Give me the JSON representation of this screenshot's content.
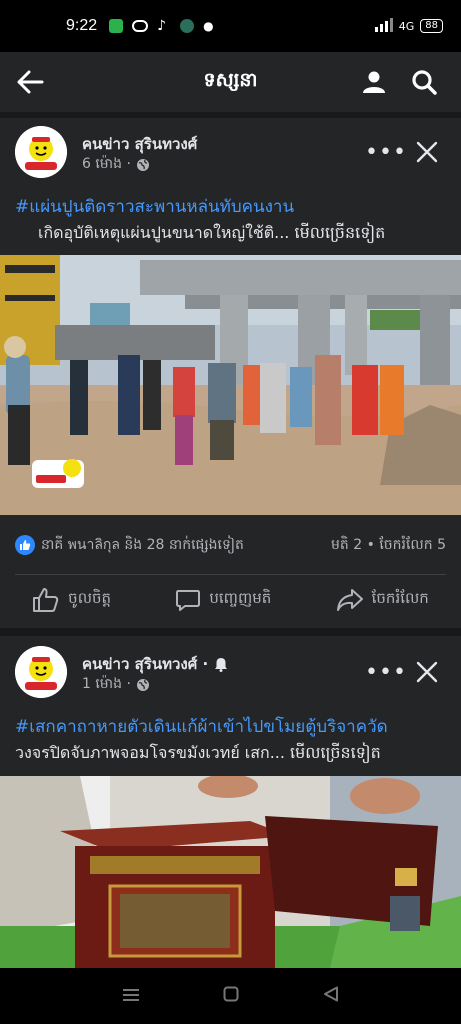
{
  "status_bar": {
    "time": "9:22",
    "network": "4G",
    "battery": "88"
  },
  "app_bar": {
    "title": "ទស្សនា"
  },
  "posts": [
    {
      "author": "คนข่าว สุรินทวงศ์",
      "time": "6 ម៉ោង ·",
      "hashtag": "#แผ่นปูนติดราวสะพานหล่นทับคนงาน",
      "body": "เกิดอุบัติเหตุแผ่นปูนขนาดใหญ่ใช้ติ...",
      "see_more": "មើលច្រើនទៀត",
      "reactions_text": "នាគី พนาลิกุล និង 28 នាក់ផ្សេងទៀត",
      "comments_shares": "មតិ 2 • ចែករំលែក 5",
      "actions": [
        "ចូលចិត្ត",
        "បញ្ចេញមតិ",
        "ចែករំលែក"
      ]
    },
    {
      "author": "คนข่าว สุรินทวงศ์ ·",
      "time": "1 ម៉ោង ·",
      "hashtag": "#เสกคาถาหายตัวเดินแก้ผ้าเข้าไปขโมยตู้บริจาควัด",
      "body": "วงจรปิดจับภาพจอมโจรขมังเวทย์ เสก...",
      "see_more": "មើលច្រើនទៀត"
    }
  ],
  "colors": {
    "background": "#18191a",
    "card": "#242526",
    "hashtag": "#4599ff",
    "like": "#2d88ff"
  }
}
